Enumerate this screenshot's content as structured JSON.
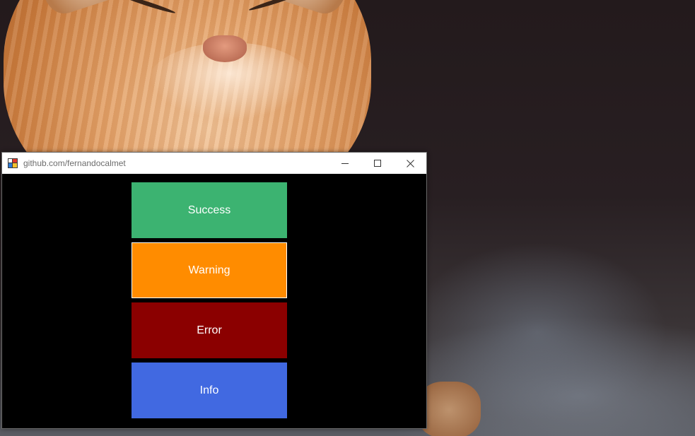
{
  "window": {
    "title": "github.com/fernandocalmet",
    "controls": {
      "minimize_icon": "minimize-icon",
      "maximize_icon": "maximize-icon",
      "close_icon": "close-icon"
    }
  },
  "buttons": [
    {
      "label": "Success",
      "color": "#3cb371"
    },
    {
      "label": "Warning",
      "color": "#ff8c00"
    },
    {
      "label": "Error",
      "color": "#8b0000"
    },
    {
      "label": "Info",
      "color": "#4169e1"
    }
  ],
  "colors": {
    "client_background": "#000000",
    "titlebar_background": "#ffffff",
    "button_text": "#ffffff"
  }
}
